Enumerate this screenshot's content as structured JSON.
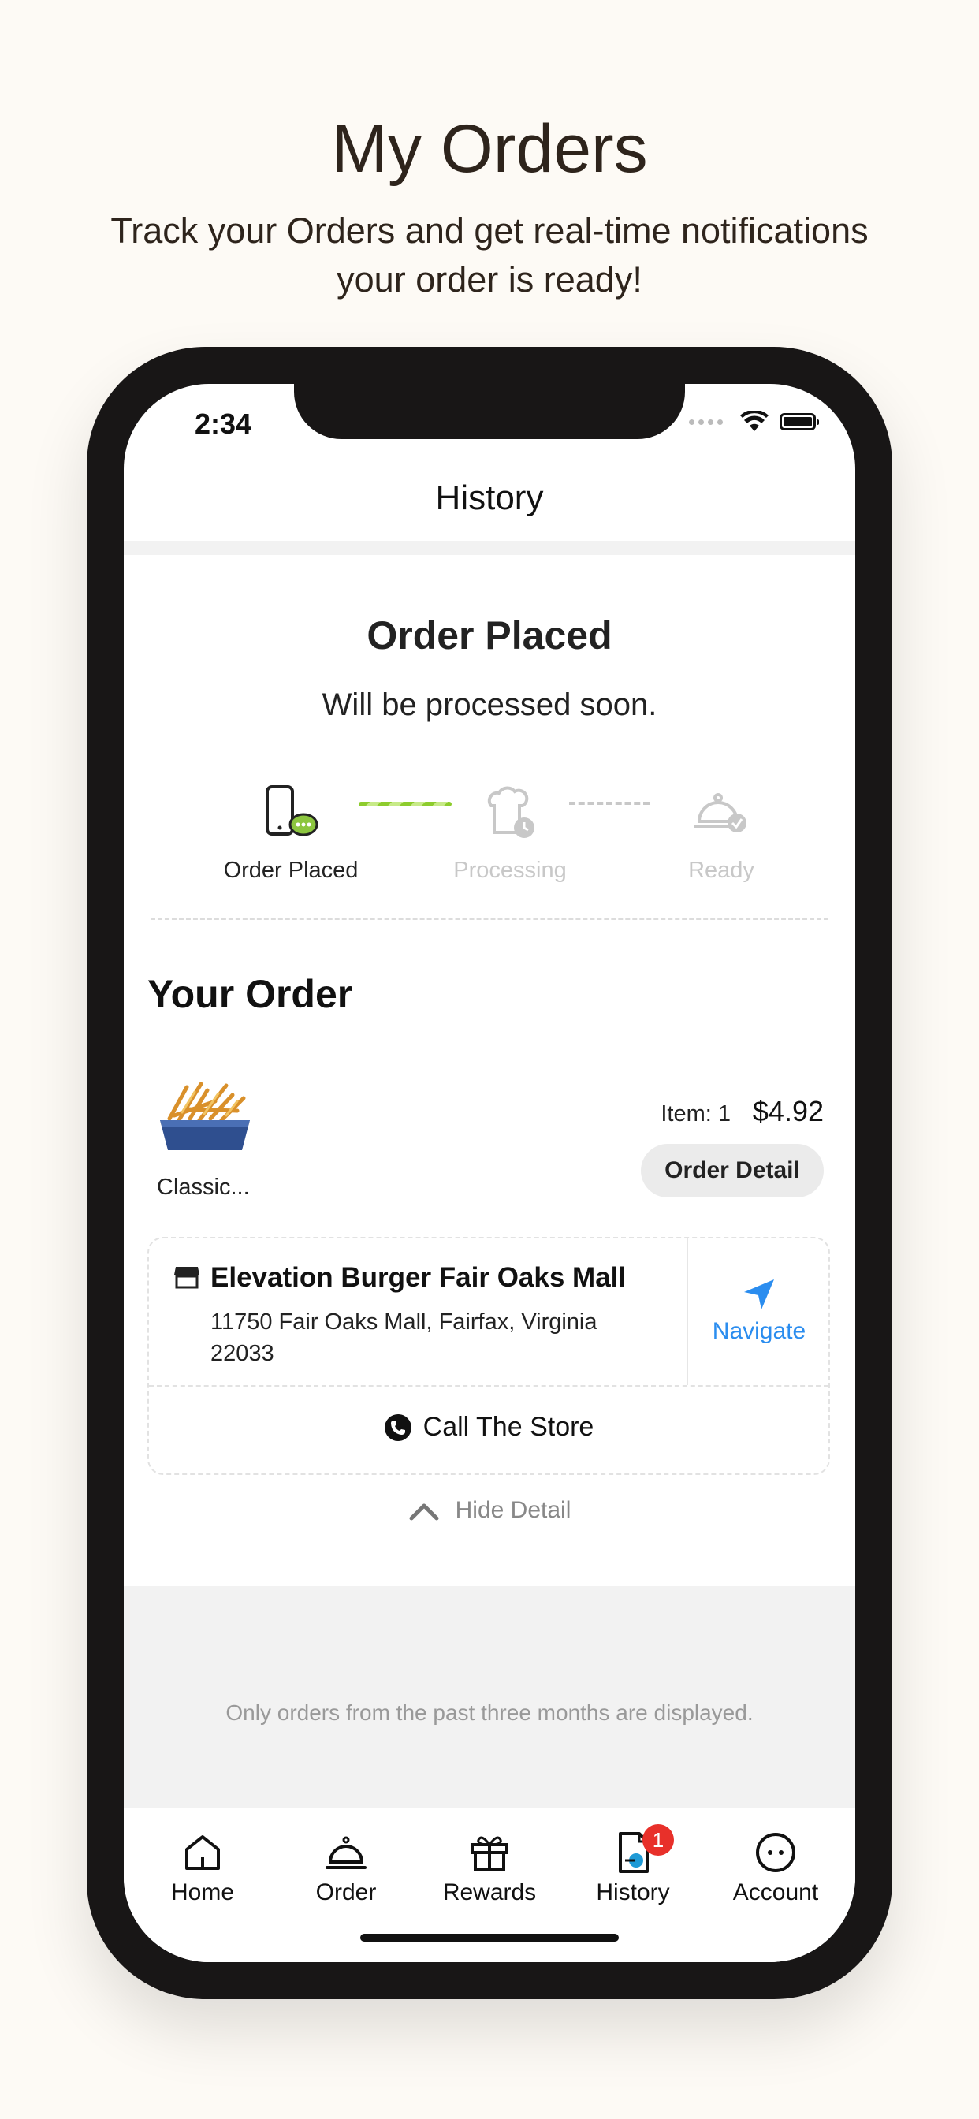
{
  "promo": {
    "title": "My Orders",
    "subtitle": "Track your Orders and get real-time notifications your order is ready!"
  },
  "status_bar": {
    "time": "2:34"
  },
  "header": {
    "title": "History"
  },
  "order": {
    "status_title": "Order Placed",
    "status_note": "Will be processed soon.",
    "steps": [
      {
        "label": "Order Placed",
        "icon": "phone-chat-icon",
        "active": true
      },
      {
        "label": "Processing",
        "icon": "chef-clock-icon",
        "active": false
      },
      {
        "label": "Ready",
        "icon": "cloche-check-icon",
        "active": false
      }
    ]
  },
  "your_order": {
    "title": "Your Order",
    "item": {
      "name": "Classic...",
      "count_label": "Item: 1",
      "price": "$4.92",
      "detail_button": "Order Detail"
    }
  },
  "store": {
    "name": "Elevation Burger Fair Oaks Mall",
    "address": "11750 Fair Oaks Mall, Fairfax, Virginia 22033",
    "navigate_label": "Navigate",
    "call_label": "Call The Store"
  },
  "hide_detail": "Hide Detail",
  "notice": "Only orders from the past three months are displayed.",
  "tabs": [
    {
      "label": "Home",
      "icon": "home-icon"
    },
    {
      "label": "Order",
      "icon": "cloche-icon"
    },
    {
      "label": "Rewards",
      "icon": "gift-icon"
    },
    {
      "label": "History",
      "icon": "document-icon",
      "badge": "1"
    },
    {
      "label": "Account",
      "icon": "face-icon"
    }
  ],
  "colors": {
    "accent_blue": "#2b8def",
    "progress_green": "#8dcc2d",
    "badge_red": "#e8302a",
    "background": "#fdfaf5"
  }
}
